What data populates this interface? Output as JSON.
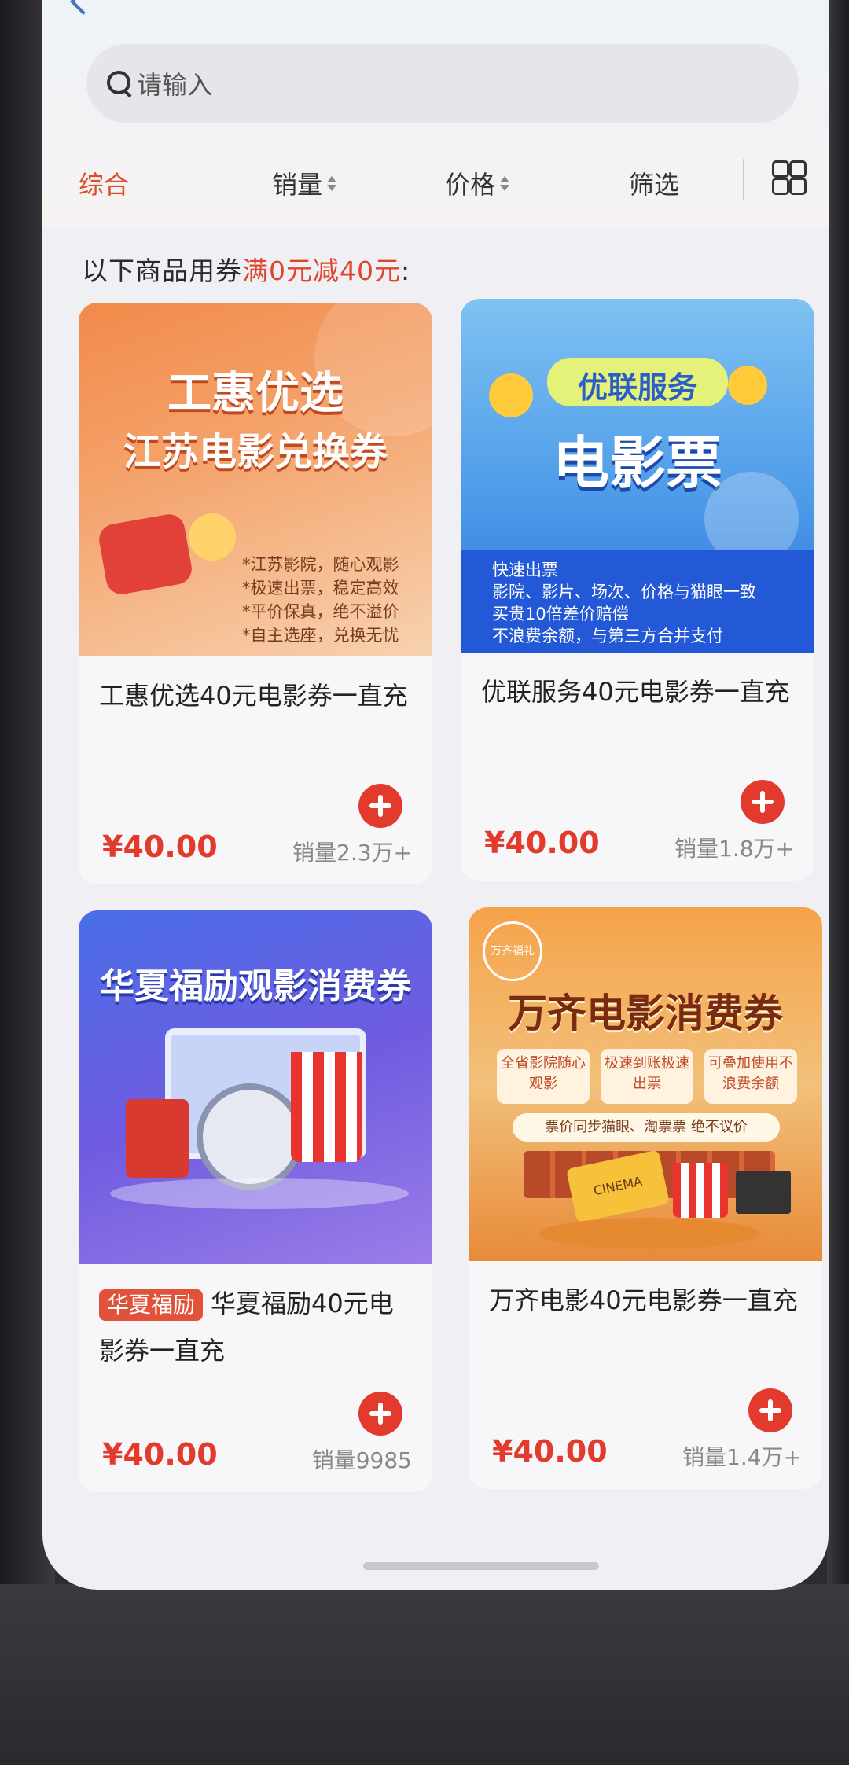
{
  "search": {
    "placeholder": "请输入"
  },
  "sortbar": {
    "items": [
      "综合",
      "销量",
      "价格",
      "筛选"
    ]
  },
  "promo": {
    "prefix": "以下商品用券",
    "highlight": "满0元减40元",
    "suffix": ":"
  },
  "products": [
    {
      "banner": {
        "line1": "工惠优选",
        "line2": "江苏电影兑换券",
        "bullets": [
          "*江苏影院，随心观影",
          "*极速出票，稳定高效",
          "*平价保真，绝不溢价",
          "*自主选座，兑换无忧"
        ]
      },
      "title": "工惠优选40元电影券一直充",
      "price": "¥40.00",
      "sales": "销量2.3万+"
    },
    {
      "banner": {
        "line1": "优联服务",
        "line2": "电影票",
        "bullets": [
          "快速出票",
          "影院、影片、场次、价格与猫眼一致",
          "买贵10倍差价赔偿",
          "不浪费余额，与第三方合并支付"
        ]
      },
      "title": "优联服务40元电影券一直充",
      "price": "¥40.00",
      "sales": "销量1.8万+"
    },
    {
      "banner": {
        "line1": "华夏福励观影消费券"
      },
      "tag": "华夏福励",
      "title": "华夏福励40元电影券一直充",
      "price": "¥40.00",
      "sales": "销量9985"
    },
    {
      "banner": {
        "logo": "万齐福礼",
        "line1": "万齐电影消费券",
        "badges": [
          "全省影院随心观影",
          "极速到账极速出票",
          "可叠加使用不浪费余额"
        ],
        "ribbon": "票价同步猫眼、淘票票 绝不议价",
        "ticket": "CINEMA"
      },
      "title": "万齐电影40元电影券一直充",
      "price": "¥40.00",
      "sales": "销量1.4万+"
    }
  ]
}
